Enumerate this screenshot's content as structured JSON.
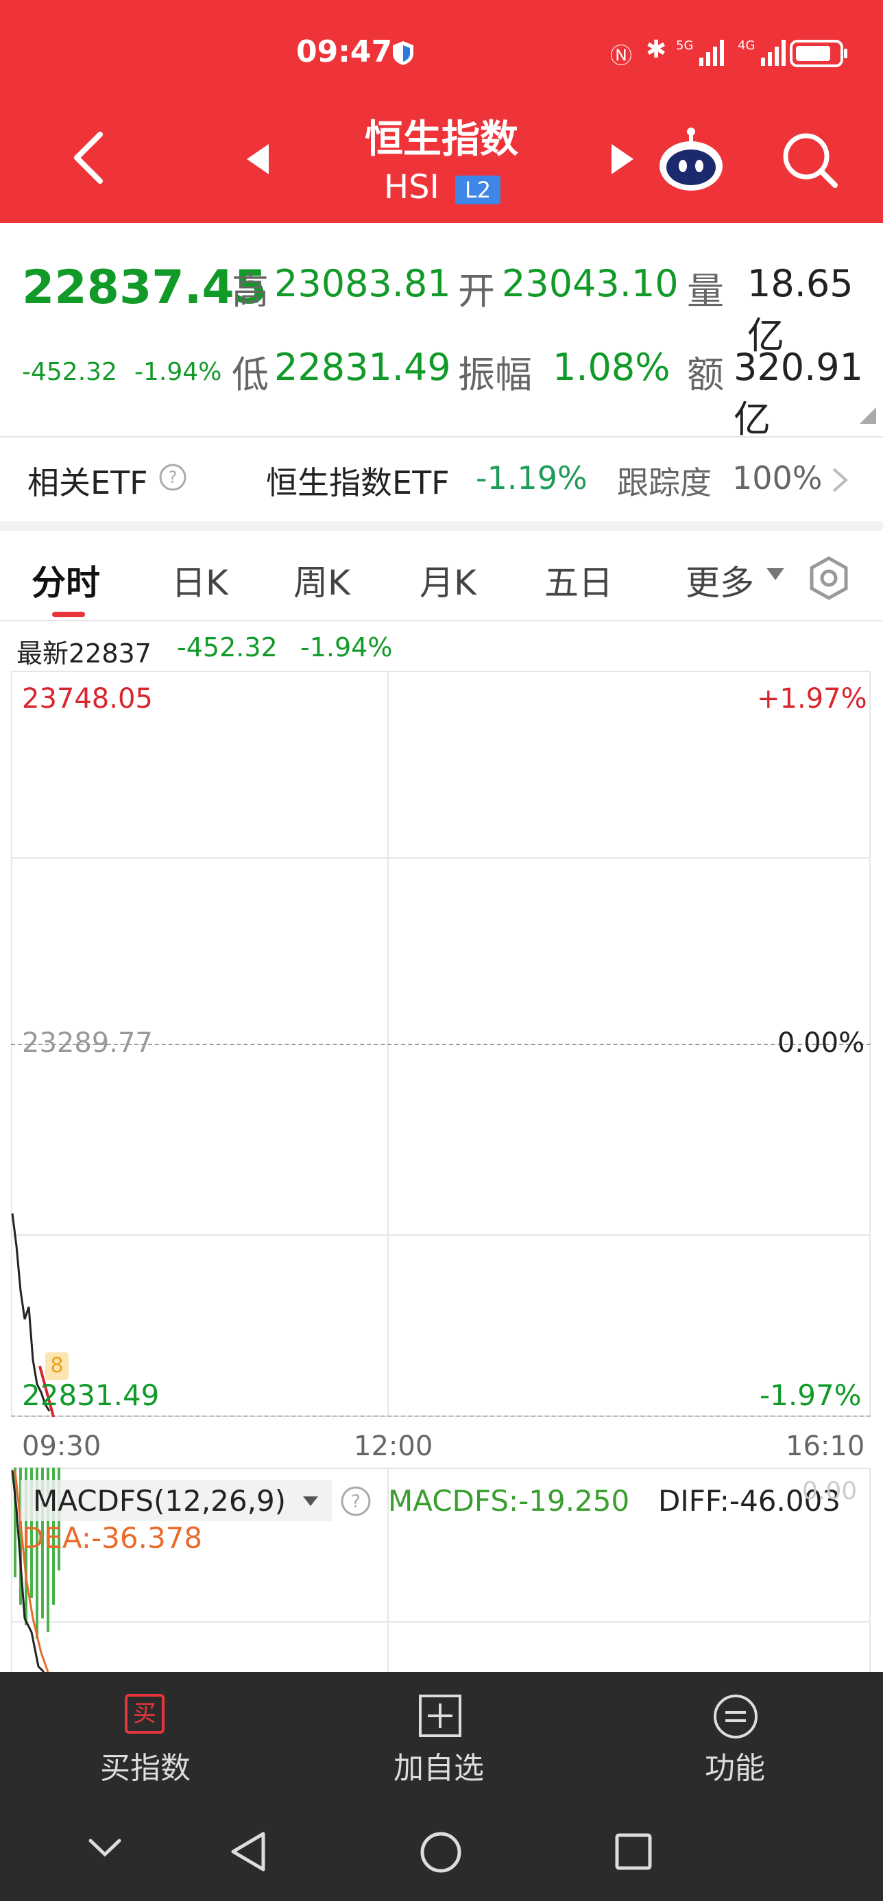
{
  "status_bar": {
    "time": "09:47"
  },
  "header": {
    "title": "恒生指数",
    "code": "HSI",
    "level_badge": "L2"
  },
  "quote": {
    "price": "22837.45",
    "change": "-452.32",
    "change_pct": "-1.94%",
    "high_label": "高",
    "high": "23083.81",
    "low_label": "低",
    "low": "22831.49",
    "open_label": "开",
    "open": "23043.10",
    "amplitude_label": "振幅",
    "amplitude": "1.08%",
    "volume_label": "量",
    "volume": "18.65亿",
    "amount_label": "额",
    "amount": "320.91亿"
  },
  "etf": {
    "label": "相关ETF",
    "name": "恒生指数ETF",
    "change": "-1.19%",
    "tracking_label": "跟踪度",
    "tracking": "100%"
  },
  "tabs": [
    "分时",
    "日K",
    "周K",
    "月K",
    "五日",
    "更多"
  ],
  "chart_info": {
    "latest": "最新22837",
    "change": "-452.32",
    "change_pct": "-1.94%"
  },
  "chart_data": {
    "type": "line",
    "y_labels": {
      "top": "23748.05",
      "mid": "23289.77",
      "bottom": "22831.49"
    },
    "pct_labels": {
      "top": "+1.97%",
      "mid": "0.00%",
      "bottom": "-1.97%"
    },
    "x_labels": [
      "09:30",
      "12:00",
      "16:10"
    ],
    "marker_label": "8",
    "price_series": [
      23080,
      23040,
      22985,
      22950,
      22965,
      22900,
      22870,
      22860,
      22845,
      22837
    ]
  },
  "macd": {
    "label": "MACDFS(12,26,9)",
    "macdfs": "MACDFS:-19.250",
    "diff": "DIFF:-46.003",
    "dea": "DEA:-36.378",
    "zero": "0.00"
  },
  "bottom_nav": [
    {
      "label": "买指数",
      "icon": "买"
    },
    {
      "label": "加自选"
    },
    {
      "label": "功能"
    }
  ]
}
